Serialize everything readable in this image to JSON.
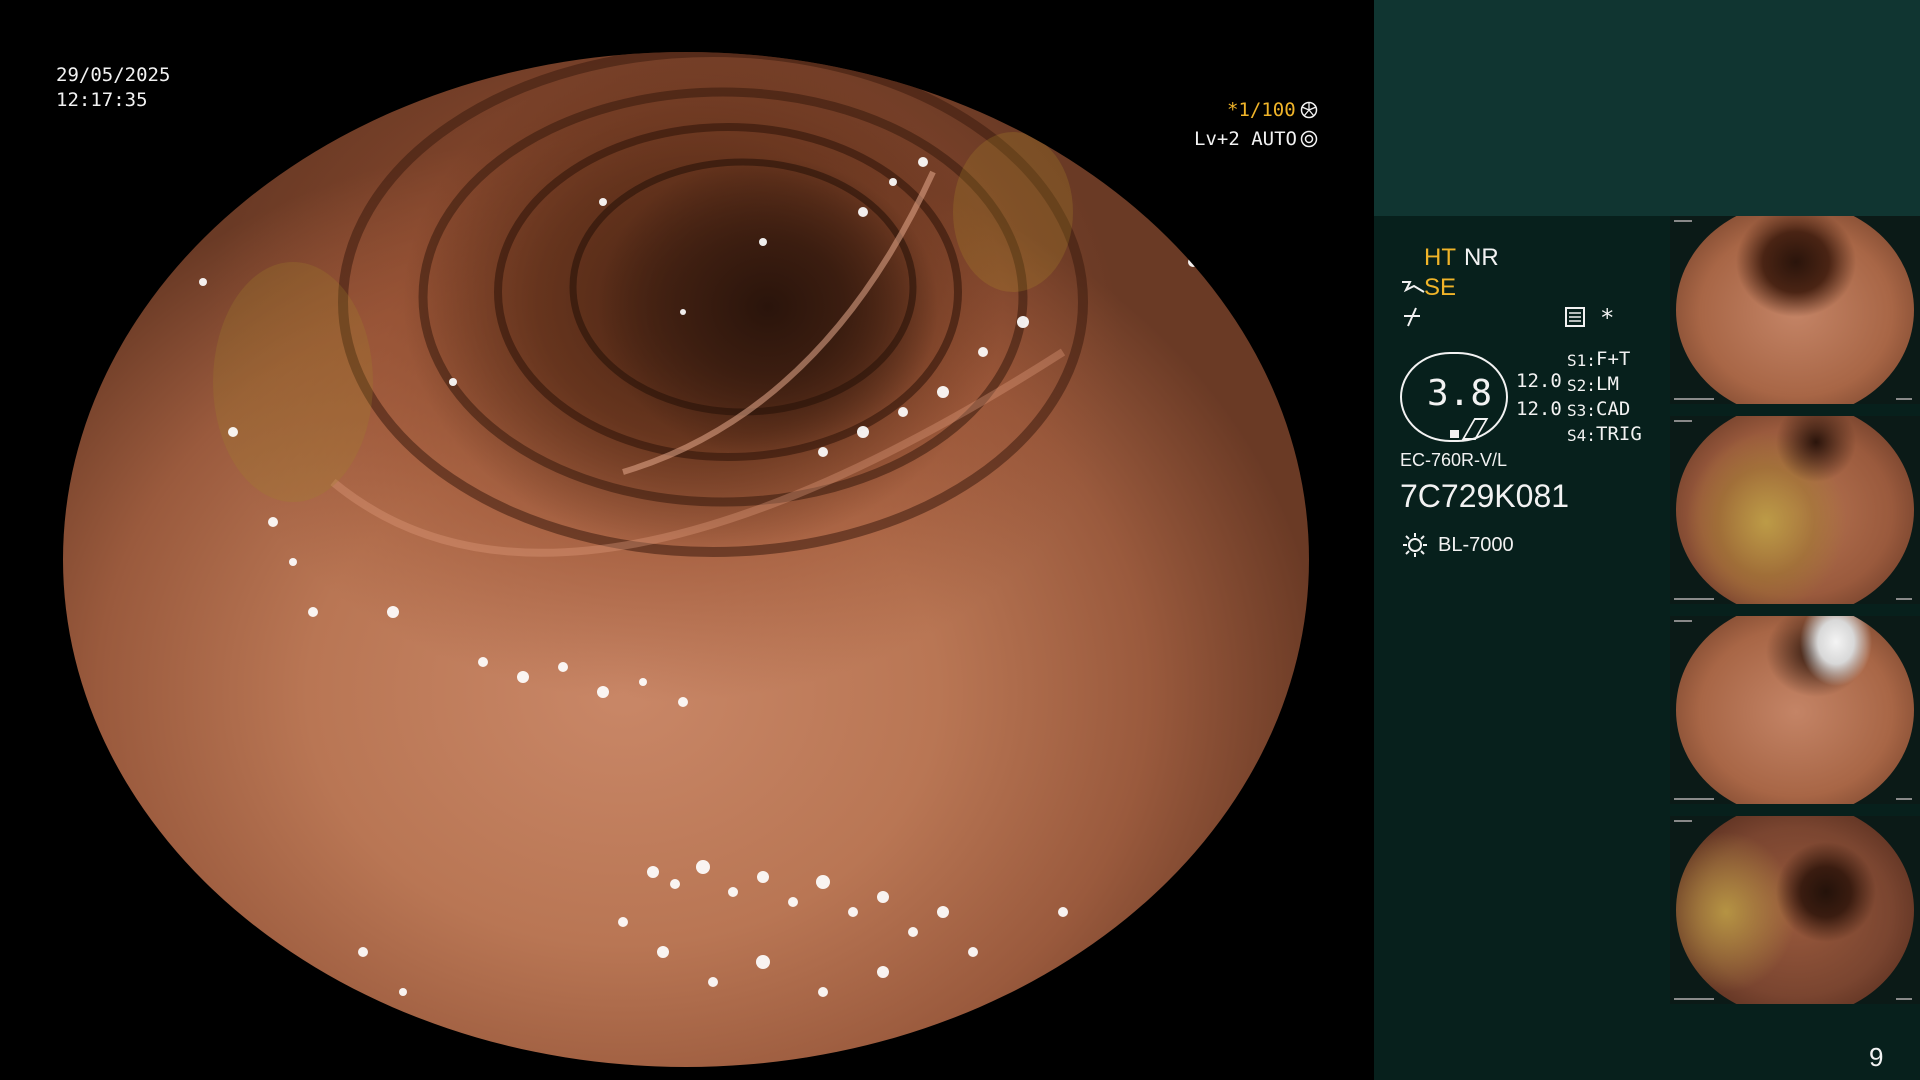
{
  "screen": {
    "date": "29/05/2025",
    "time": "12:17:35",
    "shutter": "*1/100",
    "level": "Lv+2 AUTO"
  },
  "status": {
    "mode1_a": "HT",
    "mode1_b": "NR",
    "mode2": "SE",
    "star": "*",
    "gauge_value": "3.8",
    "val_top": "12.0",
    "val_bottom": "12.0",
    "s1_key": "S1:",
    "s1_val": "F+T",
    "s2_key": "S2:",
    "s2_val": "LM",
    "s3_key": "S3:",
    "s3_val": "CAD",
    "s4_key": "S4:",
    "s4_val": "TRIG",
    "scope_model": "EC-760R-V/L",
    "scope_serial": "7C729K081",
    "light_source": "BL-7000"
  },
  "thumbnails": [
    {
      "name": "thumbnail-1"
    },
    {
      "name": "thumbnail-2"
    },
    {
      "name": "thumbnail-3"
    },
    {
      "name": "thumbnail-4"
    }
  ],
  "page_number": "9",
  "colors": {
    "sidebar": "#07201c",
    "sidebar_top": "#103531",
    "accent": "#f0b429",
    "text": "#f2f2f2"
  }
}
